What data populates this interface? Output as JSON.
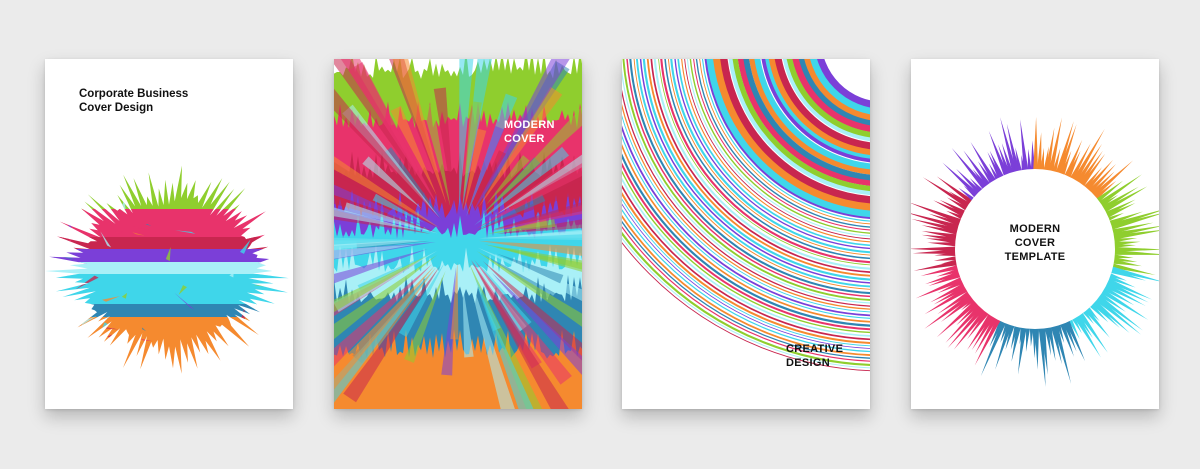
{
  "cards": [
    {
      "id": "corporate-business",
      "lines": [
        "Corporate Business",
        "Cover Design"
      ]
    },
    {
      "id": "modern-cover",
      "lines": [
        "MODERN",
        "COVER"
      ]
    },
    {
      "id": "creative-design",
      "lines": [
        "CREATIVE",
        "DESIGN"
      ]
    },
    {
      "id": "modern-cover-template",
      "lines": [
        "MODERN",
        "COVER",
        "TEMPLATE"
      ]
    }
  ],
  "palette": {
    "green": "#8fce2e",
    "pink": "#e8336b",
    "red": "#c8264f",
    "purple": "#7b3fd8",
    "cyan": "#3fd6ea",
    "light_cyan": "#a9f0f7",
    "blue": "#2f86b3",
    "orange": "#f58a2f",
    "background": "#ebebeb"
  }
}
